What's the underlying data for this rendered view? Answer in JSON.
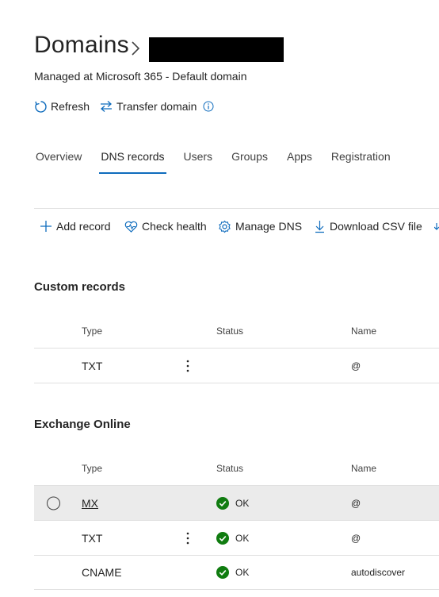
{
  "header": {
    "title": "Domains",
    "subtitle": "Managed at Microsoft 365 - Default domain",
    "actions": {
      "refresh": "Refresh",
      "transfer": "Transfer domain"
    }
  },
  "tabs": [
    "Overview",
    "DNS records",
    "Users",
    "Groups",
    "Apps",
    "Registration"
  ],
  "active_tab": "DNS records",
  "toolbar": {
    "add": "Add record",
    "health": "Check health",
    "manage": "Manage DNS",
    "download": "Download CSV file"
  },
  "columns": {
    "type": "Type",
    "status": "Status",
    "name": "Name"
  },
  "custom_records": {
    "title": "Custom records",
    "rows": [
      {
        "type": "TXT",
        "status": "",
        "name": "@"
      }
    ]
  },
  "exchange_online": {
    "title": "Exchange Online",
    "rows": [
      {
        "type": "MX",
        "status": "OK",
        "name": "@"
      },
      {
        "type": "TXT",
        "status": "OK",
        "name": "@"
      },
      {
        "type": "CNAME",
        "status": "OK",
        "name": "autodiscover"
      }
    ]
  },
  "colors": {
    "accent": "#0f6cbd",
    "ok_green": "#107c10",
    "info_blue": "#0f6cbd"
  }
}
